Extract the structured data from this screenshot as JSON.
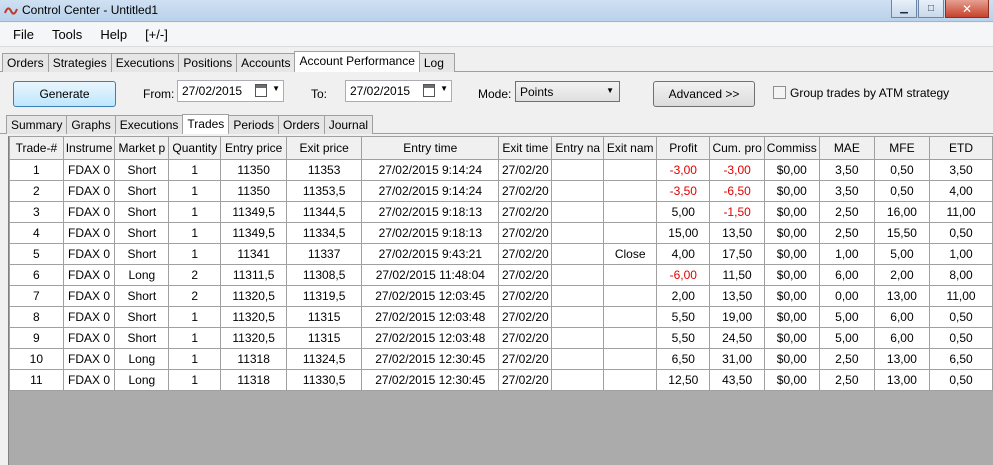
{
  "window": {
    "title": "Control Center - Untitled1"
  },
  "menu": [
    "File",
    "Tools",
    "Help",
    "[+/-]"
  ],
  "main_tabs": [
    "Orders",
    "Strategies",
    "Executions",
    "Positions",
    "Accounts",
    "Account Performance",
    "Log"
  ],
  "main_active_tab": "Account Performance",
  "toolbar": {
    "generate_label": "Generate",
    "from_label": "From:",
    "from_value": "27/02/2015",
    "to_label": "To:",
    "to_value": "27/02/2015",
    "mode_label": "Mode:",
    "mode_value": "Points",
    "advanced_label": "Advanced >>",
    "group_trades_label": "Group trades by ATM strategy"
  },
  "sub_tabs": [
    "Summary",
    "Graphs",
    "Executions",
    "Trades",
    "Periods",
    "Orders",
    "Journal"
  ],
  "sub_active_tab": "Trades",
  "colors": {
    "negative": "#e00000",
    "grid_bg": "#ababab"
  },
  "table": {
    "columns": [
      "Trade-#",
      "Instrume",
      "Market p",
      "Quantity",
      "Entry price",
      "Exit price",
      "Entry time",
      "Exit time",
      "Entry na",
      "Exit nam",
      "Profit",
      "Cum. pro",
      "Commiss",
      "MAE",
      "MFE",
      "ETD"
    ],
    "rows": [
      [
        "1",
        "FDAX 0",
        "Short",
        "1",
        "11350",
        "11353",
        "27/02/2015 9:14:24",
        "27/02/20",
        "",
        "",
        "-3,00",
        "-3,00",
        "$0,00",
        "3,50",
        "0,50",
        "3,50"
      ],
      [
        "2",
        "FDAX 0",
        "Short",
        "1",
        "11350",
        "11353,5",
        "27/02/2015 9:14:24",
        "27/02/20",
        "",
        "",
        "-3,50",
        "-6,50",
        "$0,00",
        "3,50",
        "0,50",
        "4,00"
      ],
      [
        "3",
        "FDAX 0",
        "Short",
        "1",
        "11349,5",
        "11344,5",
        "27/02/2015 9:18:13",
        "27/02/20",
        "",
        "",
        "5,00",
        "-1,50",
        "$0,00",
        "2,50",
        "16,00",
        "11,00"
      ],
      [
        "4",
        "FDAX 0",
        "Short",
        "1",
        "11349,5",
        "11334,5",
        "27/02/2015 9:18:13",
        "27/02/20",
        "",
        "",
        "15,00",
        "13,50",
        "$0,00",
        "2,50",
        "15,50",
        "0,50"
      ],
      [
        "5",
        "FDAX 0",
        "Short",
        "1",
        "11341",
        "11337",
        "27/02/2015 9:43:21",
        "27/02/20",
        "",
        "Close",
        "4,00",
        "17,50",
        "$0,00",
        "1,00",
        "5,00",
        "1,00"
      ],
      [
        "6",
        "FDAX 0",
        "Long",
        "2",
        "11311,5",
        "11308,5",
        "27/02/2015 11:48:04",
        "27/02/20",
        "",
        "",
        "-6,00",
        "11,50",
        "$0,00",
        "6,00",
        "2,00",
        "8,00"
      ],
      [
        "7",
        "FDAX 0",
        "Short",
        "2",
        "11320,5",
        "11319,5",
        "27/02/2015 12:03:45",
        "27/02/20",
        "",
        "",
        "2,00",
        "13,50",
        "$0,00",
        "0,00",
        "13,00",
        "11,00"
      ],
      [
        "8",
        "FDAX 0",
        "Short",
        "1",
        "11320,5",
        "11315",
        "27/02/2015 12:03:48",
        "27/02/20",
        "",
        "",
        "5,50",
        "19,00",
        "$0,00",
        "5,00",
        "6,00",
        "0,50"
      ],
      [
        "9",
        "FDAX 0",
        "Short",
        "1",
        "11320,5",
        "11315",
        "27/02/2015 12:03:48",
        "27/02/20",
        "",
        "",
        "5,50",
        "24,50",
        "$0,00",
        "5,00",
        "6,00",
        "0,50"
      ],
      [
        "10",
        "FDAX 0",
        "Long",
        "1",
        "11318",
        "11324,5",
        "27/02/2015 12:30:45",
        "27/02/20",
        "",
        "",
        "6,50",
        "31,00",
        "$0,00",
        "2,50",
        "13,00",
        "6,50"
      ],
      [
        "11",
        "FDAX 0",
        "Long",
        "1",
        "11318",
        "11330,5",
        "27/02/2015 12:30:45",
        "27/02/20",
        "",
        "",
        "12,50",
        "43,50",
        "$0,00",
        "2,50",
        "13,00",
        "0,50"
      ]
    ]
  }
}
